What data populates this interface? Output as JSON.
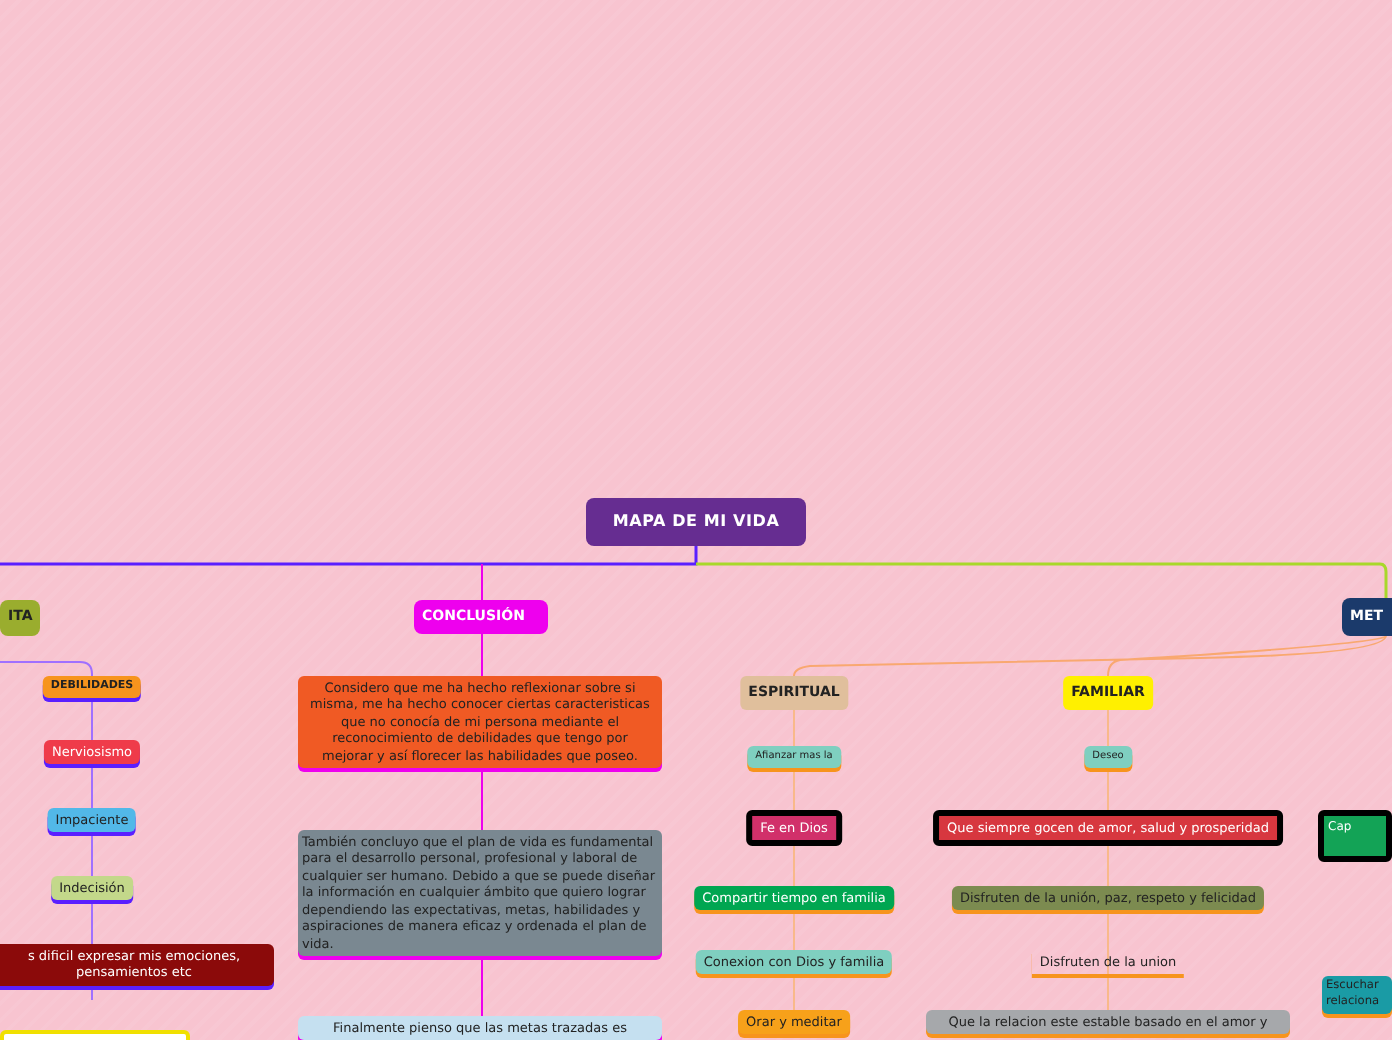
{
  "root": {
    "label": "MAPA DE MI VIDA",
    "color": "#662d91"
  },
  "branches": [
    {
      "label": "ITA",
      "color": "#9aad2e",
      "groups": [
        {
          "children": [
            {
              "label": "DEBILIDADES",
              "color": "#f7941d",
              "kind": "box"
            },
            {
              "label": "Nerviosismo",
              "color": "#ef3b4a",
              "kind": "box"
            },
            {
              "label": "Impaciente",
              "color": "#52b8e8",
              "kind": "box"
            },
            {
              "label": "Indecisión",
              "color": "#c3d88a",
              "kind": "box"
            },
            {
              "label": "s dificil expresar mis emociones, pensamientos etc",
              "color": "#8b0a0a",
              "kind": "box"
            }
          ]
        }
      ]
    },
    {
      "label": "CONCLUSIÓN",
      "color": "#ee00ee",
      "groups": [
        {
          "children": [
            {
              "label": "Considero que me ha hecho reflexionar sobre   si misma, me ha hecho conocer ciertas caracteristicas  que no conocía de mi persona mediante el reconocimiento de  debilidades que tengo por  mejorar  y así   florecer  las habilidades que poseo.",
              "color": "#f05a24",
              "kind": "box"
            },
            {
              "label": "También  concluyo que  el plan de vida es fundamental  para el desarrollo personal, profesional  y laboral de cualquier ser humano. Debido a que  se puede  diseñar  la información en cualquier ámbito que quiero lograr dependiendo las expectativas, metas, habilidades y aspiraciones  de manera  eficaz y ordenada el plan de vida.",
              "color": "#7a8891",
              "kind": "box"
            },
            {
              "label": "Finalmente  pienso que  las metas trazadas  es",
              "color": "#c5e0f0",
              "kind": "box"
            }
          ]
        }
      ]
    },
    {
      "label": "MET",
      "color": "#1b3a6b",
      "groups": [
        {
          "label": "ESPIRITUAL",
          "color": "#e0bf9c",
          "children": [
            {
              "label": "Afianzar mas la",
              "color": "#7fcfc0",
              "kind": "box"
            },
            {
              "label": "Fe en Dios",
              "color": "#d1306a",
              "kind": "framed"
            },
            {
              "label": "Compartir tiempo en familia",
              "color": "#00a651",
              "kind": "box"
            },
            {
              "label": "Conexion con Dios y familia",
              "color": "#7fcfc0",
              "kind": "box"
            },
            {
              "label": "Orar y meditar",
              "color": "#f7a11a",
              "kind": "box"
            }
          ]
        },
        {
          "label": "FAMILIAR",
          "color": "#fff000",
          "children": [
            {
              "label": "Deseo",
              "color": "#7fcfc0",
              "kind": "box"
            },
            {
              "label": "Que siempre gocen de amor, salud y prosperidad",
              "color": "#d7373f",
              "kind": "framed"
            },
            {
              "label": "Disfruten de la unión, paz, respeto y felicidad",
              "color": "#7c8b50",
              "kind": "box"
            },
            {
              "label": "Disfruten de la union",
              "kind": "plain"
            },
            {
              "label": "Que la relacion este estable basado en el amor y",
              "color": "#a6a8ab",
              "kind": "box"
            }
          ]
        },
        {
          "children": [
            {
              "label": "Cap",
              "color": "#13a356",
              "kind": "framed"
            },
            {
              "label": "Escuchar relaciona",
              "color": "#1a9ba5",
              "kind": "box"
            }
          ]
        }
      ]
    }
  ]
}
